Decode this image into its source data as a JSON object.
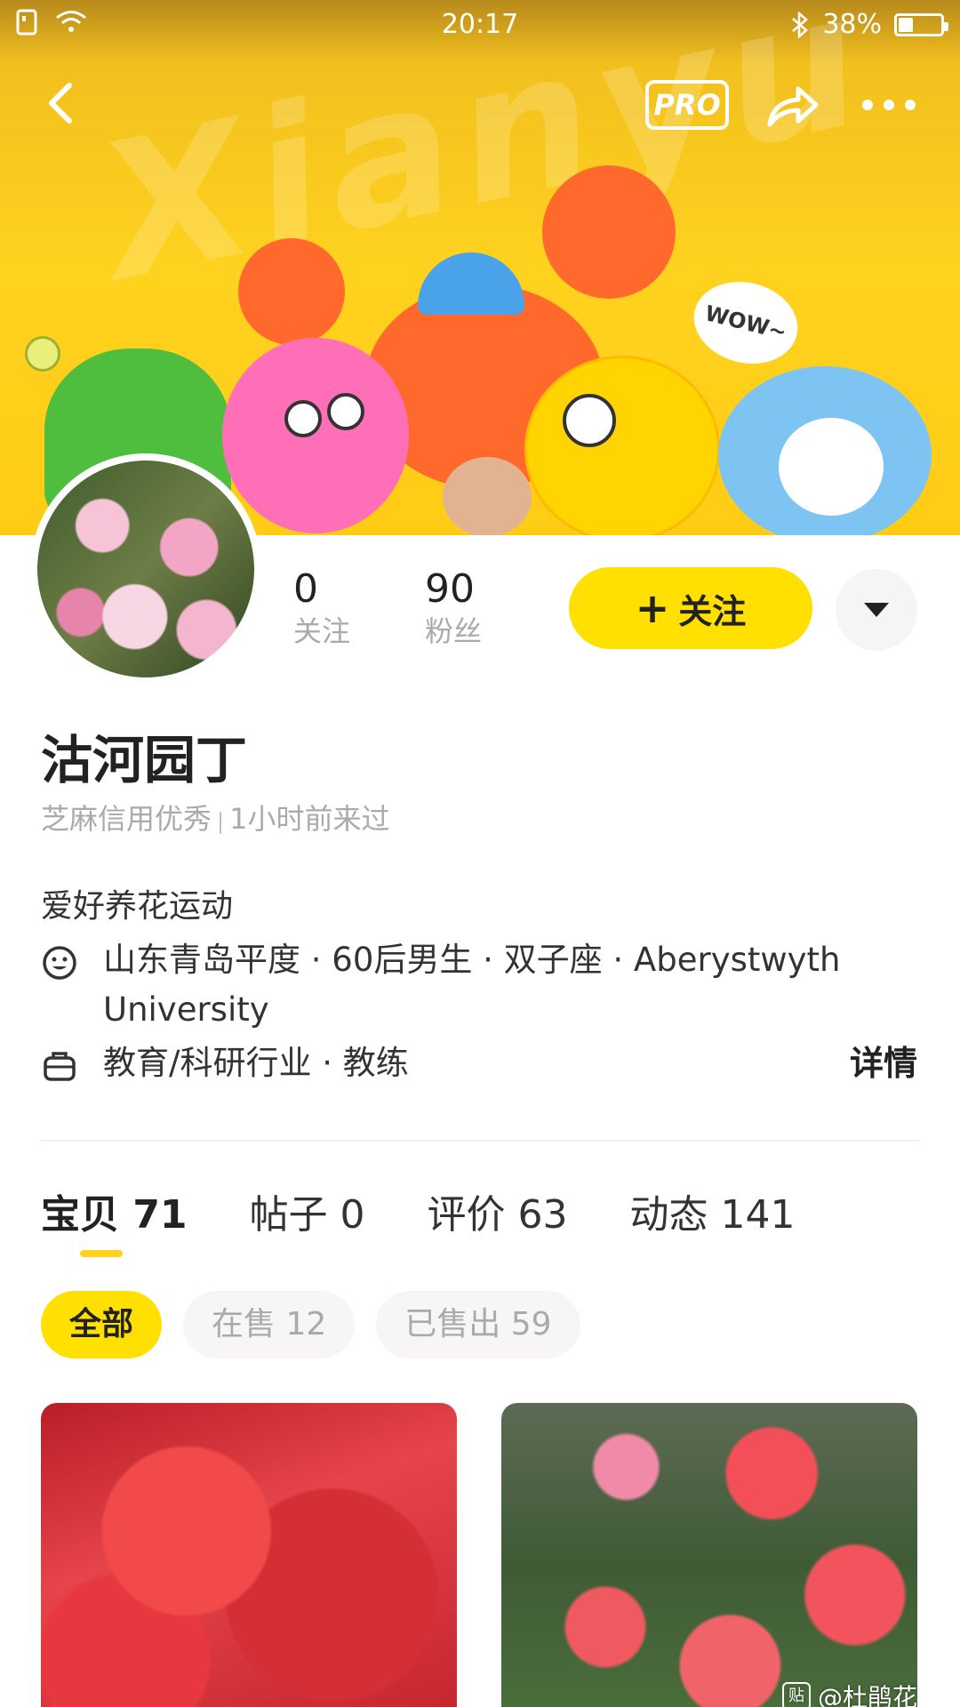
{
  "status_bar": {
    "time": "20:17",
    "battery": "38%"
  },
  "nav": {
    "pro_label": "PRO"
  },
  "banner": {
    "watermark": "Xianyu",
    "bubble": "WOW~"
  },
  "profile": {
    "following_count": "0",
    "following_label": "关注",
    "fans_count": "90",
    "fans_label": "粉丝",
    "follow_button": "关注",
    "username": "沽河园丁",
    "credit": "芝麻信用优秀",
    "separator": "|",
    "last_seen": "1小时前来过",
    "bio": "爱好养花运动",
    "personal_info": "山东青岛平度 · 60后男生 · 双子座 · Aberystwyth University",
    "job_info": "教育/科研行业 · 教练",
    "details_link": "详情"
  },
  "tabs": [
    {
      "label": "宝贝 71"
    },
    {
      "label": "帖子 0"
    },
    {
      "label": "评价 63"
    },
    {
      "label": "动态 141"
    }
  ],
  "filters": [
    {
      "label": "全部"
    },
    {
      "label": "在售 12"
    },
    {
      "label": "已售出 59"
    }
  ],
  "products": [
    {
      "watermark": ""
    },
    {
      "watermark": "@杜鹃花"
    }
  ],
  "colors": {
    "accent": "#ffe000",
    "banner": "#ffd21f"
  }
}
